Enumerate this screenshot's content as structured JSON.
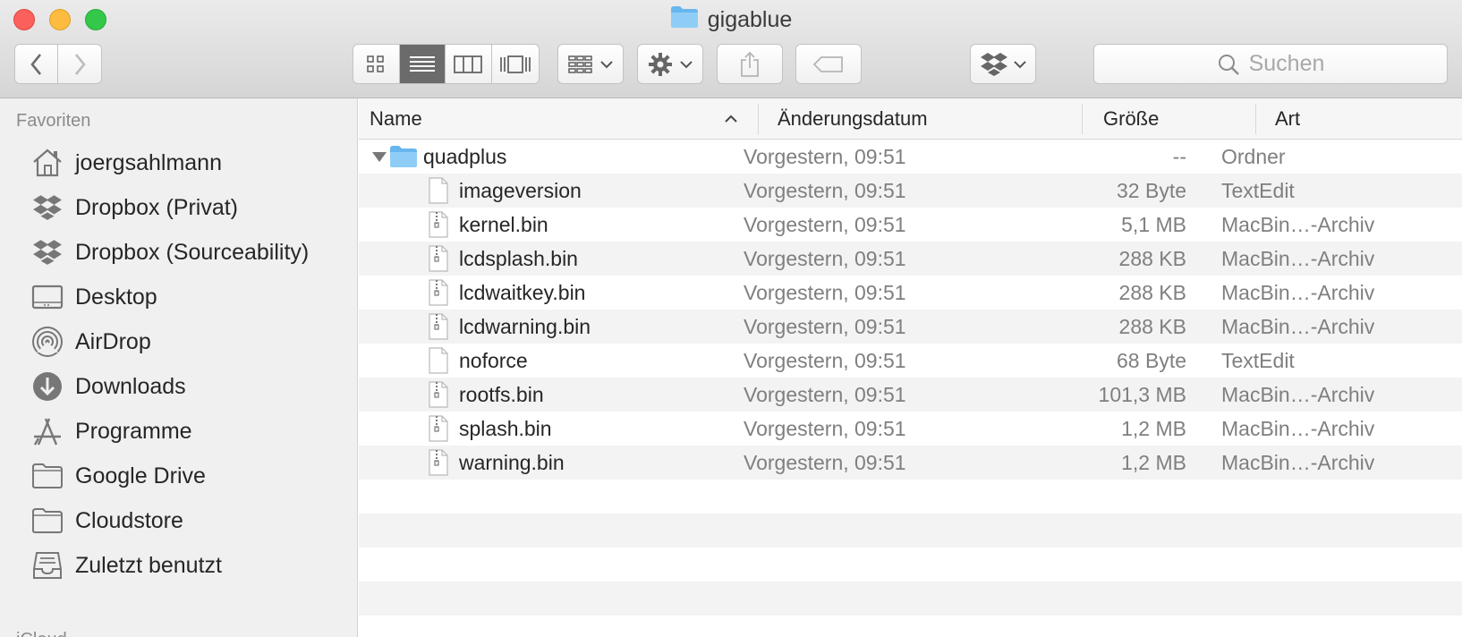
{
  "window": {
    "title": "gigablue",
    "folder_icon": "folder-icon"
  },
  "toolbar": {
    "back_icon": "chevron-left-icon",
    "forward_icon": "chevron-right-icon",
    "view_modes": [
      "icon-view",
      "list-view",
      "column-view",
      "cover-flow-view"
    ],
    "active_view": "list-view",
    "search_placeholder": "Suchen"
  },
  "sidebar": {
    "favorites_heading": "Favoriten",
    "items": [
      {
        "label": "joergsahlmann",
        "icon": "home-icon"
      },
      {
        "label": "Dropbox (Privat)",
        "icon": "dropbox-icon"
      },
      {
        "label": "Dropbox (Sourceability)",
        "icon": "dropbox-icon"
      },
      {
        "label": "Desktop",
        "icon": "desktop-icon"
      },
      {
        "label": "AirDrop",
        "icon": "airdrop-icon"
      },
      {
        "label": "Downloads",
        "icon": "download-icon"
      },
      {
        "label": "Programme",
        "icon": "applications-icon"
      },
      {
        "label": "Google Drive",
        "icon": "folder-icon"
      },
      {
        "label": "Cloudstore",
        "icon": "folder-icon"
      },
      {
        "label": "Zuletzt benutzt",
        "icon": "recents-icon"
      }
    ],
    "next_heading": "iCloud"
  },
  "columns": {
    "name": "Name",
    "date": "Änderungsdatum",
    "size": "Größe",
    "kind": "Art"
  },
  "rows": [
    {
      "name": "quadplus",
      "date": "Vorgestern, 09:51",
      "size": "--",
      "kind": "Ordner",
      "type": "folder"
    },
    {
      "name": "imageversion",
      "date": "Vorgestern, 09:51",
      "size": "32 Byte",
      "kind": "TextEdit",
      "type": "text"
    },
    {
      "name": "kernel.bin",
      "date": "Vorgestern, 09:51",
      "size": "5,1 MB",
      "kind": "MacBin…-Archiv",
      "type": "archive"
    },
    {
      "name": "lcdsplash.bin",
      "date": "Vorgestern, 09:51",
      "size": "288 KB",
      "kind": "MacBin…-Archiv",
      "type": "archive"
    },
    {
      "name": "lcdwaitkey.bin",
      "date": "Vorgestern, 09:51",
      "size": "288 KB",
      "kind": "MacBin…-Archiv",
      "type": "archive"
    },
    {
      "name": "lcdwarning.bin",
      "date": "Vorgestern, 09:51",
      "size": "288 KB",
      "kind": "MacBin…-Archiv",
      "type": "archive"
    },
    {
      "name": "noforce",
      "date": "Vorgestern, 09:51",
      "size": "68 Byte",
      "kind": "TextEdit",
      "type": "text"
    },
    {
      "name": "rootfs.bin",
      "date": "Vorgestern, 09:51",
      "size": "101,3 MB",
      "kind": "MacBin…-Archiv",
      "type": "archive"
    },
    {
      "name": "splash.bin",
      "date": "Vorgestern, 09:51",
      "size": "1,2 MB",
      "kind": "MacBin…-Archiv",
      "type": "archive"
    },
    {
      "name": "warning.bin",
      "date": "Vorgestern, 09:51",
      "size": "1,2 MB",
      "kind": "MacBin…-Archiv",
      "type": "archive"
    }
  ]
}
